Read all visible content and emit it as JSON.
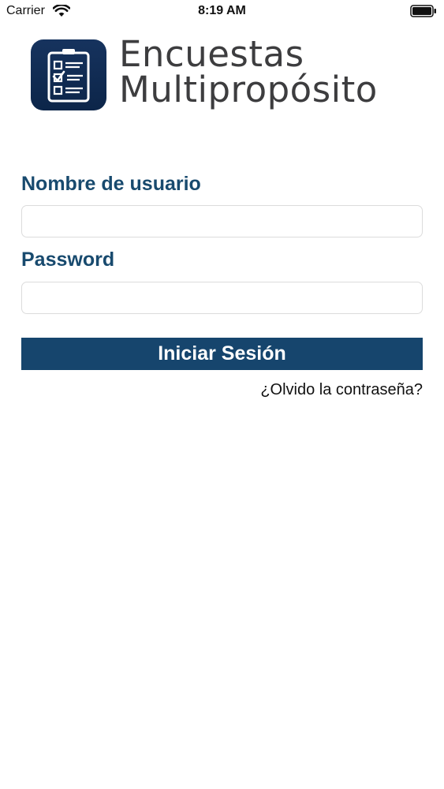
{
  "status_bar": {
    "carrier": "Carrier",
    "time": "8:19 AM",
    "wifi_icon": "wifi-icon",
    "battery_icon": "battery-icon"
  },
  "header": {
    "logo_icon": "clipboard-checklist-icon",
    "title_line1": "Encuestas",
    "title_line2": "Multipropósito"
  },
  "form": {
    "username_label": "Nombre de usuario",
    "username_value": "",
    "password_label": "Password",
    "password_value": "",
    "login_button_label": "Iniciar Sesión",
    "forgot_password_label": "¿Olvido la contraseña?"
  },
  "colors": {
    "primary": "#16456d",
    "label": "#184a6e",
    "logo_background": "#0f2a52",
    "brand_text": "#3d3d3f",
    "background": "#ffffff"
  }
}
